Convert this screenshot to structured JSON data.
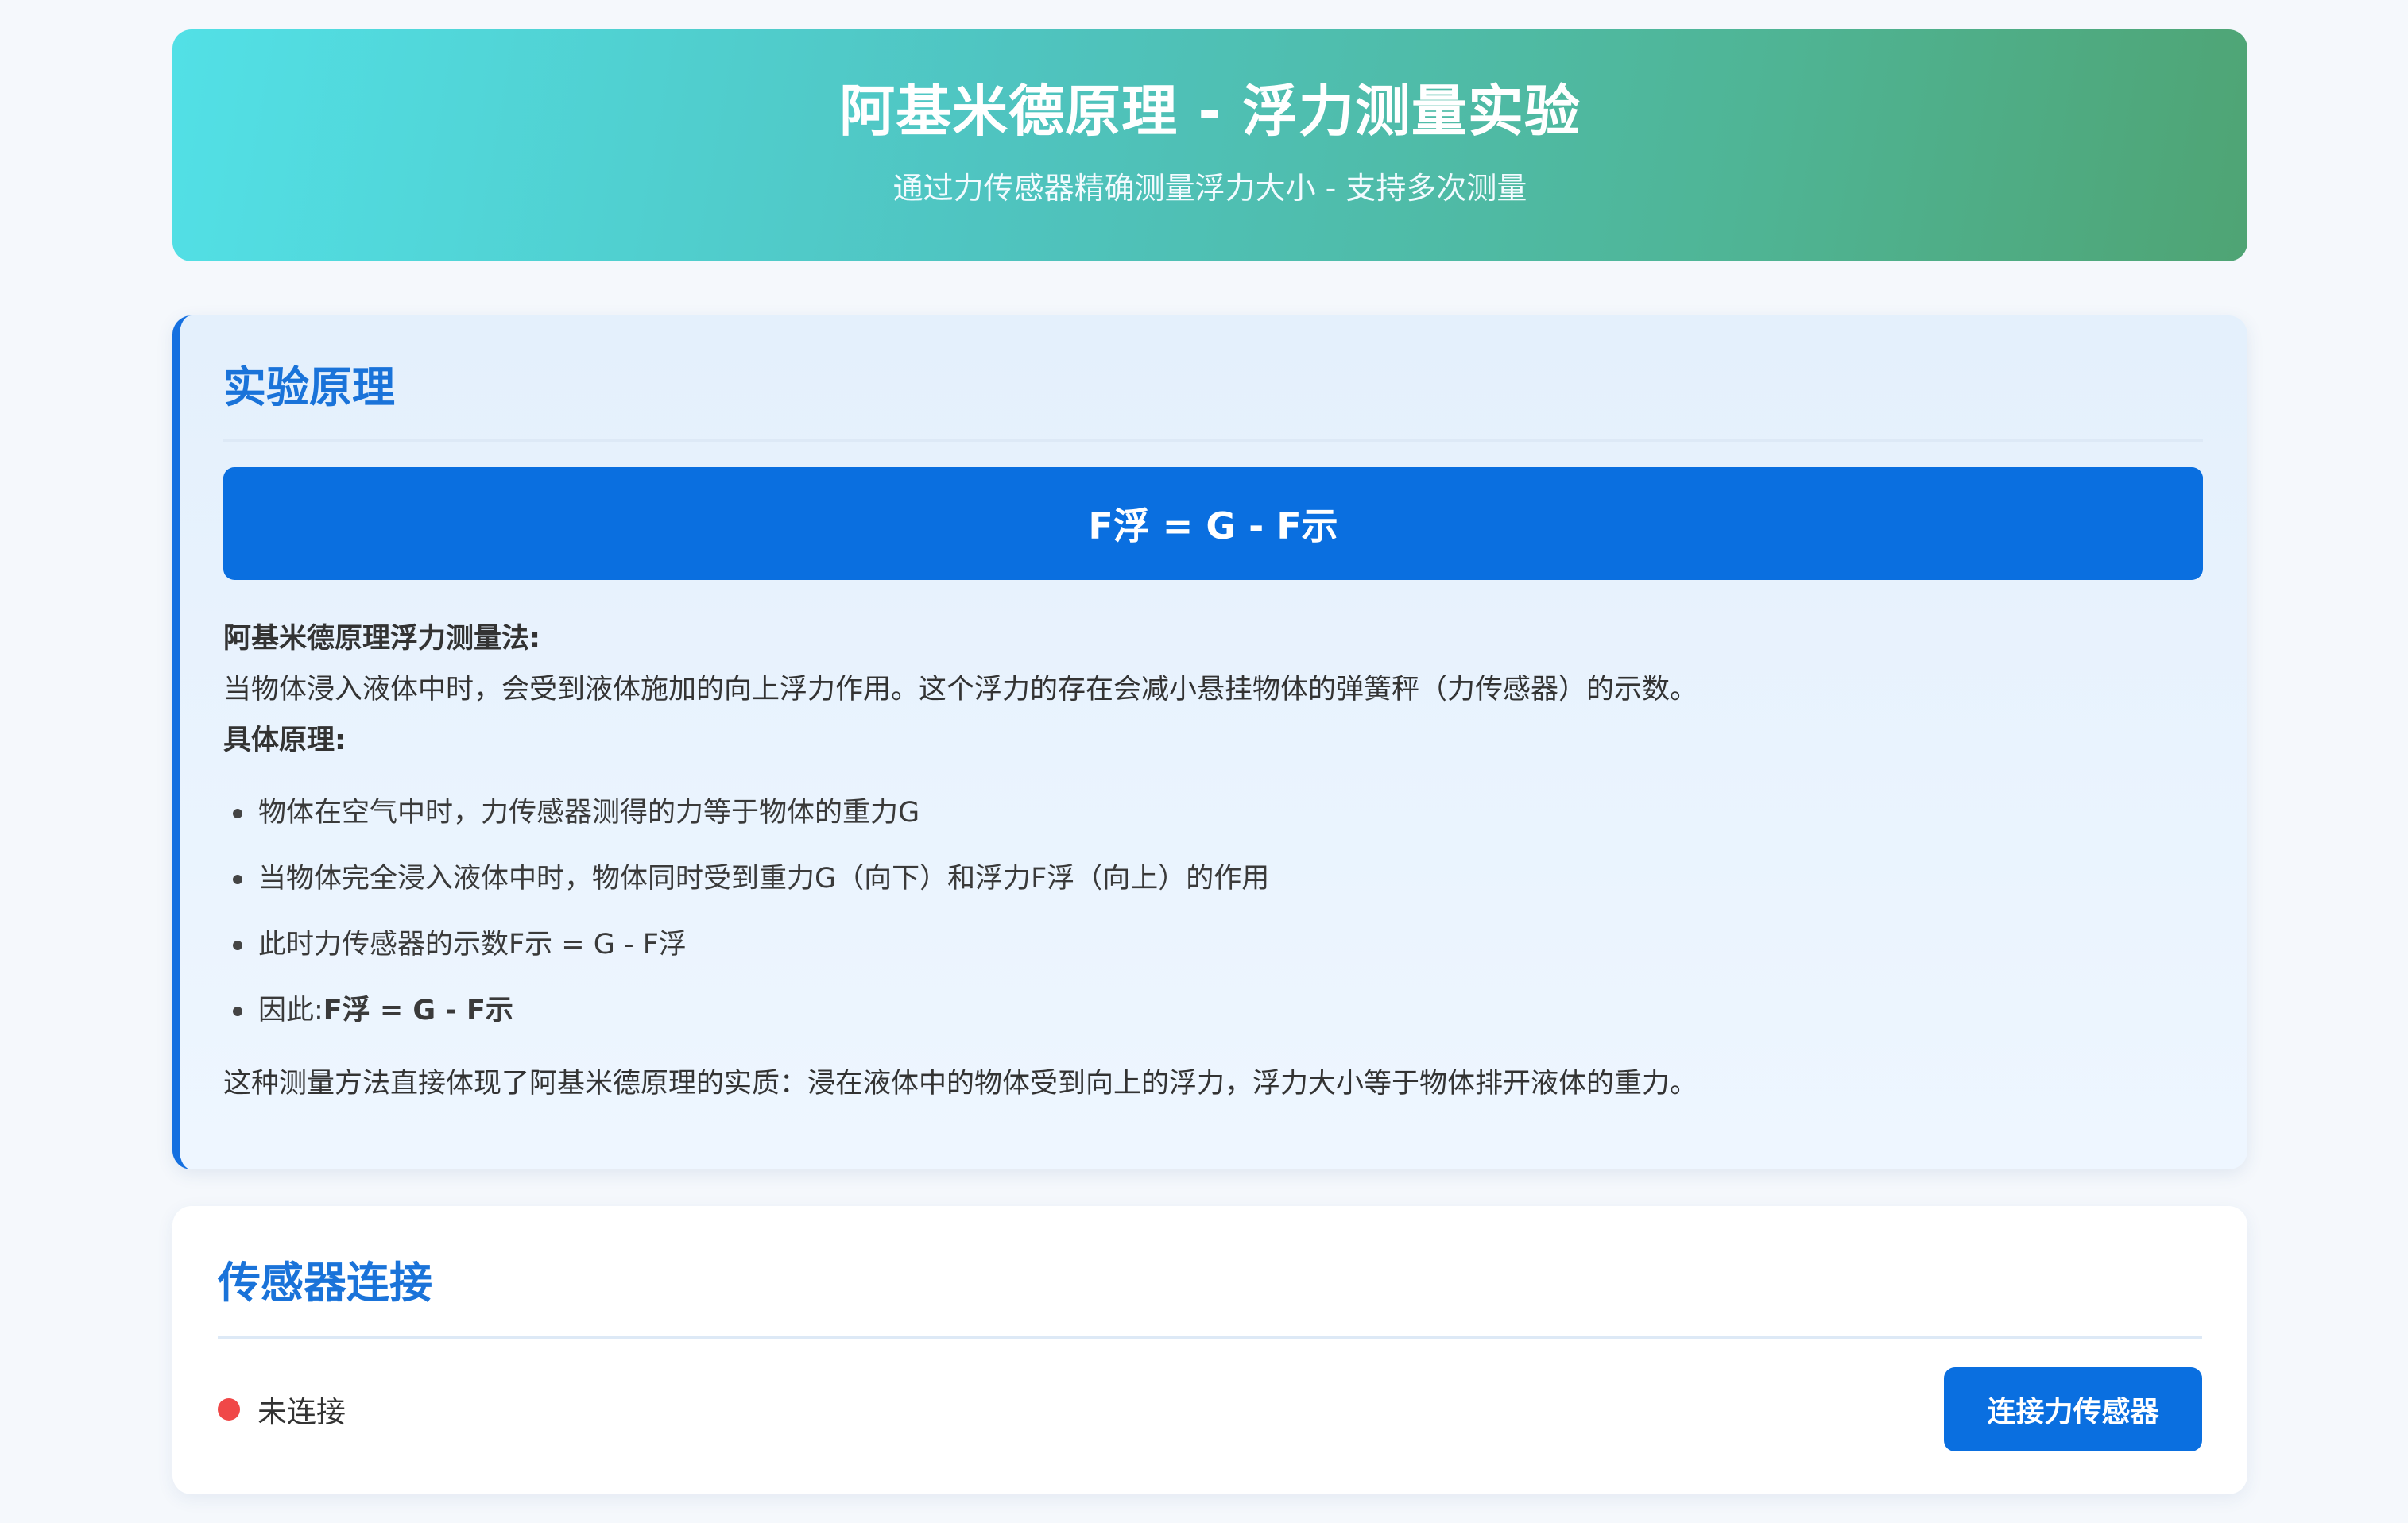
{
  "header": {
    "title": "阿基米德原理 - 浮力测量实验",
    "subtitle": "通过力传感器精确测量浮力大小 - 支持多次测量"
  },
  "principle": {
    "title": "实验原理",
    "formula": "F浮 = G - F示",
    "method_heading": "阿基米德原理浮力测量法:",
    "method_text": "当物体浸入液体中时，会受到液体施加的向上浮力作用。这个浮力的存在会减小悬挂物体的弹簧秤（力传感器）的示数。",
    "detail_heading": "具体原理:",
    "items": [
      "物体在空气中时，力传感器测得的力等于物体的重力G",
      "当物体完全浸入液体中时，物体同时受到重力G（向下）和浮力F浮（向上）的作用",
      "此时力传感器的示数F示 = G - F浮"
    ],
    "therefore_label": "因此:",
    "therefore_formula": "F浮 = G - F示",
    "conclusion": "这种测量方法直接体现了阿基米德原理的实质：浸在液体中的物体受到向上的浮力，浮力大小等于物体排开液体的重力。"
  },
  "sensor": {
    "title": "传感器连接",
    "status_text": "未连接",
    "status_color": "#f04848",
    "connect_label": "连接力传感器"
  }
}
